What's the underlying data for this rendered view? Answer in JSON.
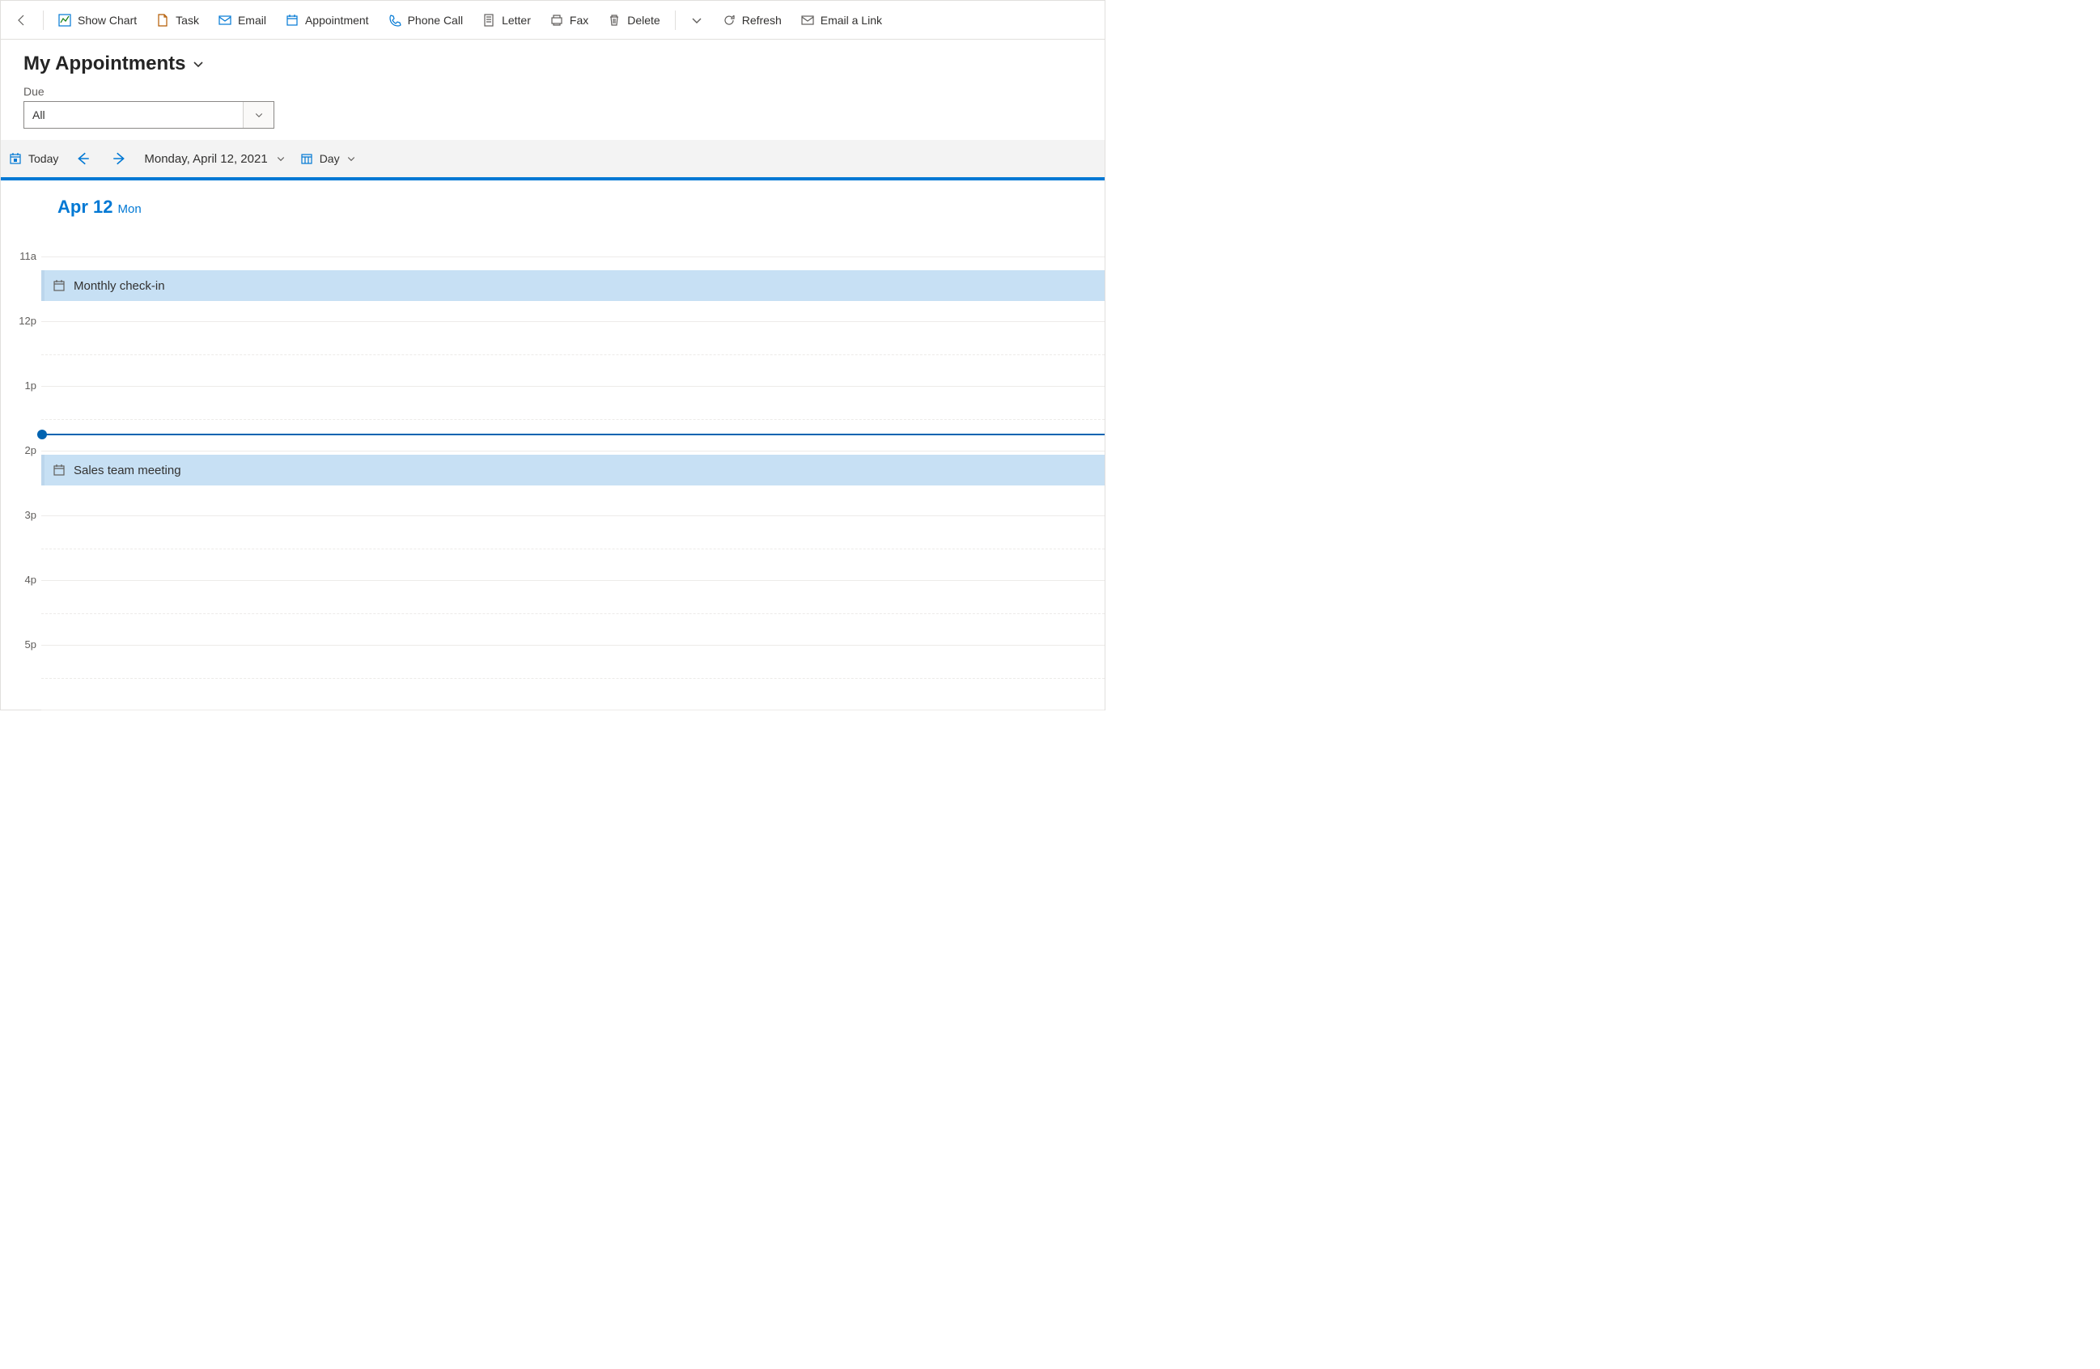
{
  "commandBar": {
    "showChart": "Show Chart",
    "task": "Task",
    "email": "Email",
    "appointment": "Appointment",
    "phoneCall": "Phone Call",
    "letter": "Letter",
    "fax": "Fax",
    "delete": "Delete",
    "refresh": "Refresh",
    "emailLink": "Email a Link"
  },
  "page": {
    "title": "My Appointments"
  },
  "filter": {
    "label": "Due",
    "value": "All"
  },
  "nav": {
    "today": "Today",
    "dateLabel": "Monday, April 12, 2021",
    "viewMode": "Day"
  },
  "calendar": {
    "dateShort": "Apr 12",
    "dayShort": "Mon",
    "hours": [
      "11a",
      "12p",
      "1p",
      "2p",
      "3p",
      "4p",
      "5p"
    ],
    "events": [
      {
        "title": "Monthly check-in",
        "hourIndex": 0,
        "offsetPct": 20
      },
      {
        "title": "Sales team meeting",
        "hourIndex": 3,
        "offsetPct": 5
      }
    ],
    "nowIndicatorHourIndex": 2,
    "nowIndicatorOffsetPct": 72
  }
}
